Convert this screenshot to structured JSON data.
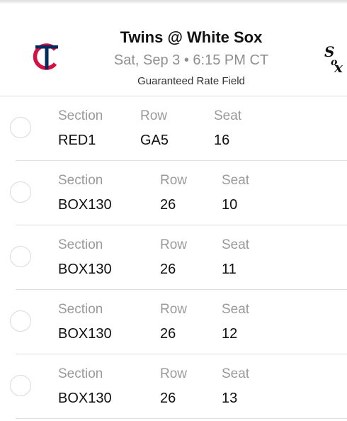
{
  "event": {
    "title": "Twins @ White Sox",
    "datetime": "Sat, Sep 3 • 6:15 PM CT",
    "venue": "Guaranteed Rate Field",
    "home_logo": "twins-tc-logo-icon",
    "away_logo": "white-sox-logo-icon"
  },
  "labels": {
    "section": "Section",
    "row": "Row",
    "seat": "Seat"
  },
  "tickets": [
    {
      "section": "RED1",
      "row": "GA5",
      "seat": "16"
    },
    {
      "section": "BOX130",
      "row": "26",
      "seat": "10"
    },
    {
      "section": "BOX130",
      "row": "26",
      "seat": "11"
    },
    {
      "section": "BOX130",
      "row": "26",
      "seat": "12"
    },
    {
      "section": "BOX130",
      "row": "26",
      "seat": "13"
    }
  ],
  "colors": {
    "twins_red": "#d31145",
    "twins_navy": "#002b5c",
    "muted": "#9a9a9a",
    "divider": "#dedede"
  }
}
